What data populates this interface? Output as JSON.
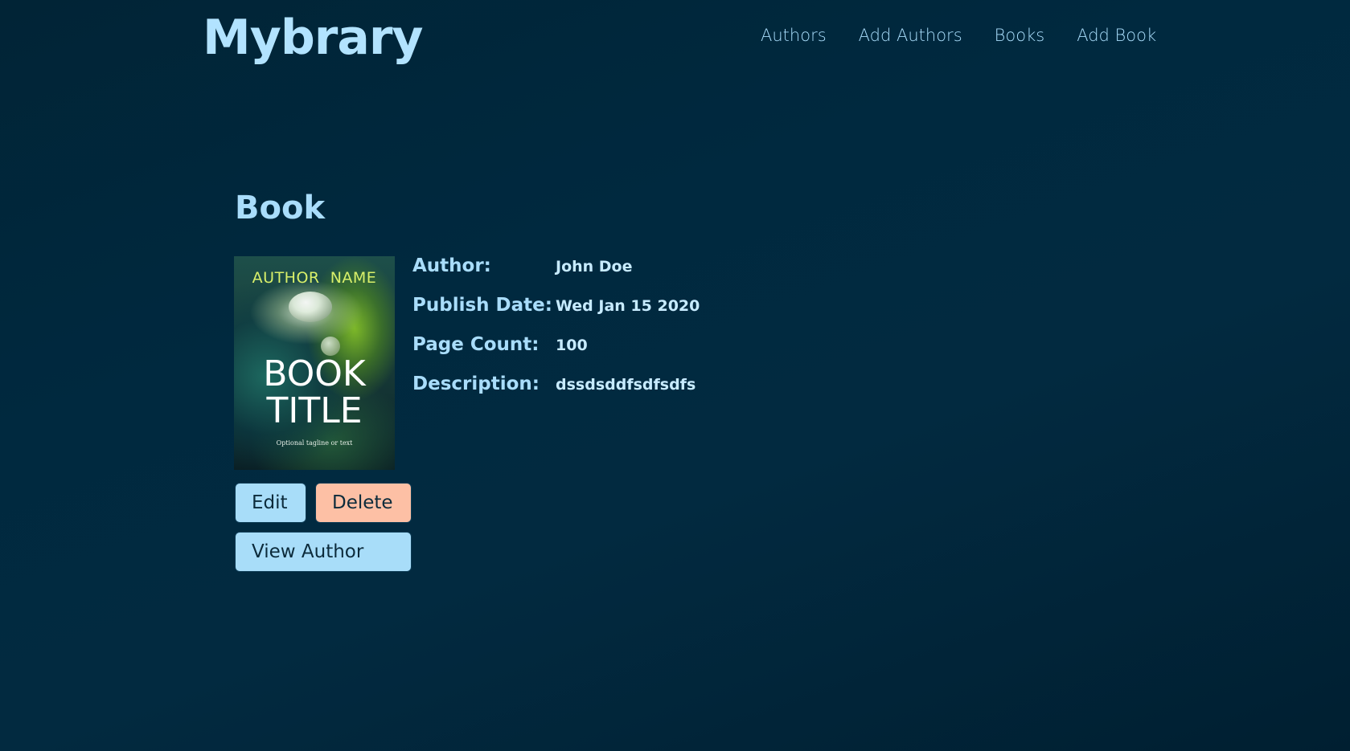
{
  "header": {
    "logo": "Mybrary",
    "nav": [
      "Authors",
      "Add Authors",
      "Books",
      "Add Book"
    ]
  },
  "page": {
    "title": "Book"
  },
  "cover": {
    "author_name": "AUTHOR  NAME",
    "title_line1": "BOOK",
    "title_line2": "TITLE",
    "tagline": "Optional tagline or text"
  },
  "details": [
    {
      "label": "Author:",
      "value": "John Doe"
    },
    {
      "label": "Publish Date:",
      "value": "Wed Jan 15 2020"
    },
    {
      "label": "Page Count:",
      "value": "100"
    },
    {
      "label": "Description:",
      "value": "dssdsddfsdfsdfs"
    }
  ],
  "buttons": {
    "edit": "Edit",
    "delete": "Delete",
    "view_author": "View Author"
  },
  "colors": {
    "accent": "#a8ddf9",
    "danger": "#fdc0a5",
    "background": "#022a40"
  }
}
